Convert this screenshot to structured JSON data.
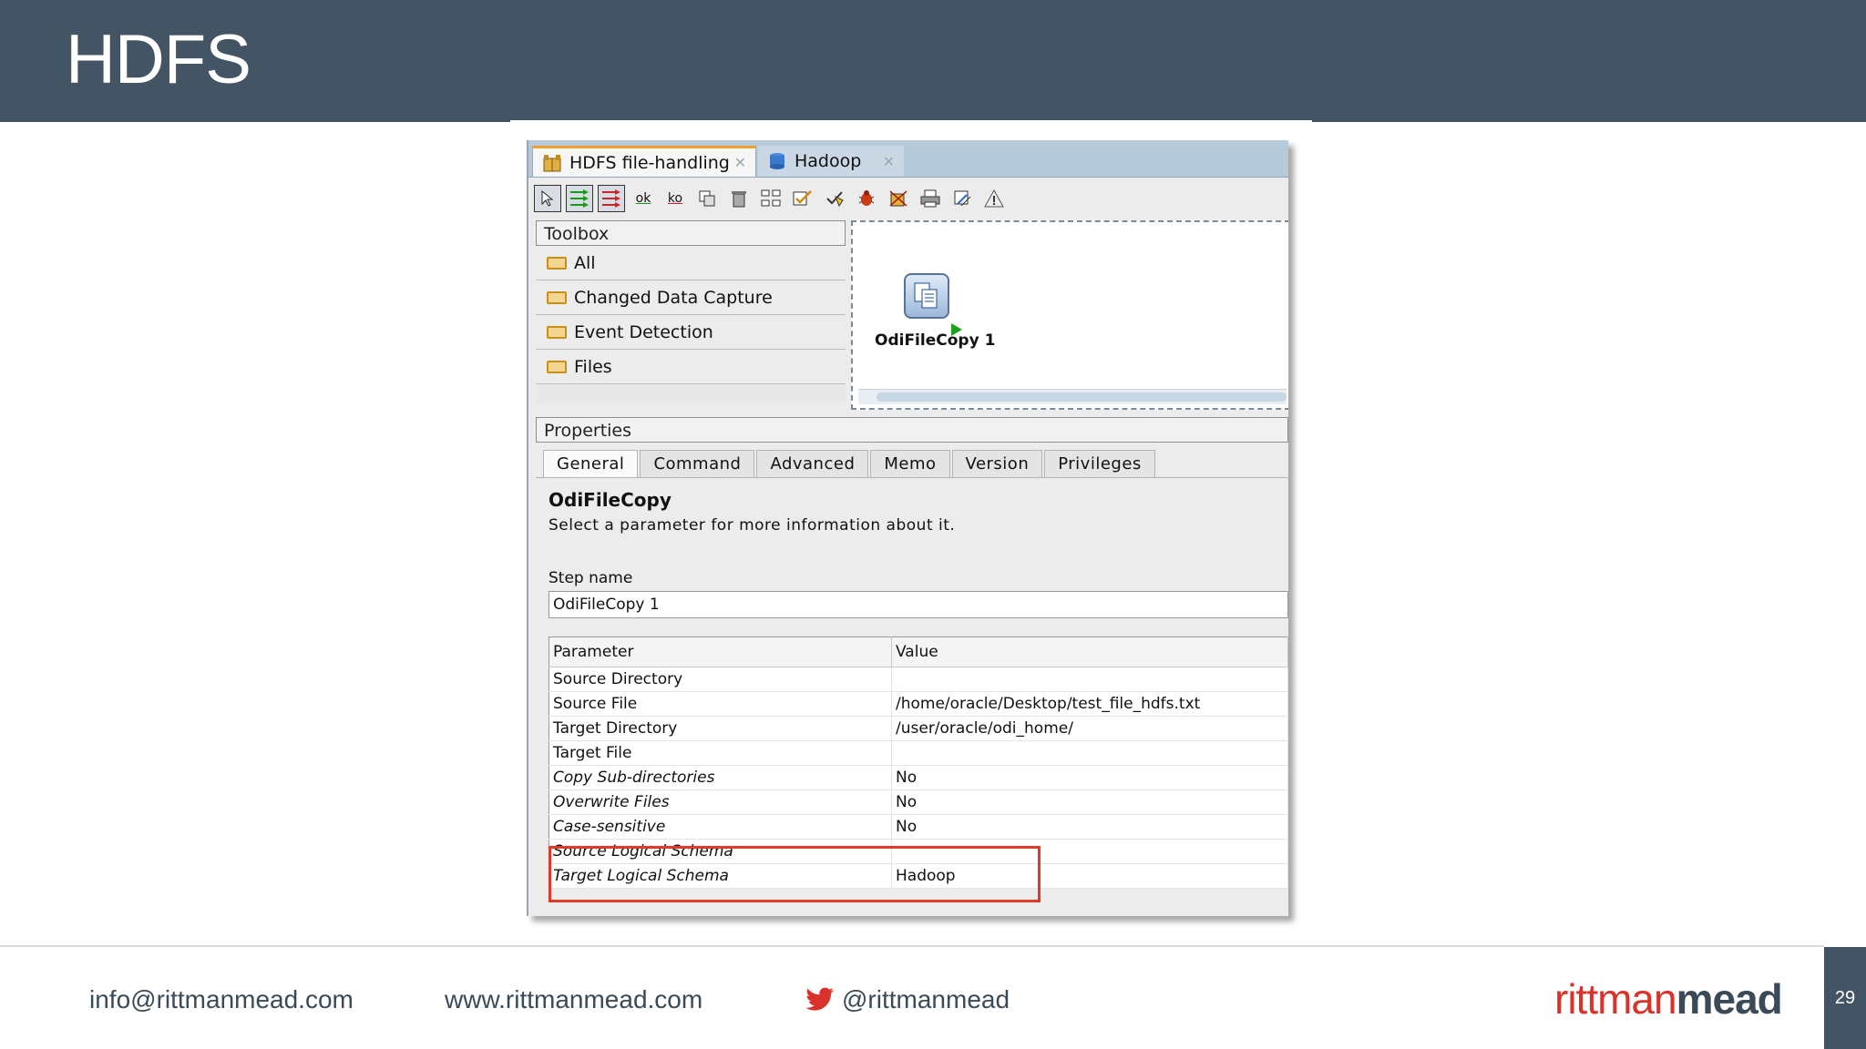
{
  "slide": {
    "title": "HDFS",
    "page_number": "29"
  },
  "editor_tabs": [
    {
      "label": "HDFS file-handling",
      "active": true
    },
    {
      "label": "Hadoop",
      "active": false
    }
  ],
  "toolbar": {
    "icons": [
      "select-arrow-icon",
      "next-step-ok-icon",
      "next-step-ko-icon",
      "ok-label-icon",
      "ko-label-icon",
      "duplicate-icon",
      "delete-icon",
      "layout-icon",
      "validate-icon",
      "execute-icon",
      "debug-icon",
      "stop-icon",
      "print-icon",
      "page-setup-icon",
      "warning-icon"
    ],
    "ok_label": "ok",
    "ko_label": "ko"
  },
  "toolbox": {
    "title": "Toolbox",
    "items": [
      "All",
      "Changed Data Capture",
      "Event Detection",
      "Files"
    ]
  },
  "diagram": {
    "node_label": "OdiFileCopy 1"
  },
  "properties": {
    "title": "Properties",
    "tabs": [
      "General",
      "Command",
      "Advanced",
      "Memo",
      "Version",
      "Privileges"
    ],
    "active_tab": "General",
    "heading": "OdiFileCopy",
    "description": "Select a parameter for more information about it.",
    "step_name_label": "Step name",
    "step_name_value": "OdiFileCopy 1",
    "table": {
      "headers": [
        "Parameter",
        "Value"
      ],
      "rows": [
        {
          "param": "Source Directory",
          "value": "",
          "italic": false
        },
        {
          "param": "Source File",
          "value": "/home/oracle/Desktop/test_file_hdfs.txt",
          "italic": false
        },
        {
          "param": "Target Directory",
          "value": "/user/oracle/odi_home/",
          "italic": false
        },
        {
          "param": "Target File",
          "value": "",
          "italic": false
        },
        {
          "param": "Copy Sub-directories",
          "value": "No",
          "italic": true
        },
        {
          "param": "Overwrite Files",
          "value": "No",
          "italic": true
        },
        {
          "param": "Case-sensitive",
          "value": "No",
          "italic": true
        },
        {
          "param": "Source Logical Schema",
          "value": "",
          "italic": true
        },
        {
          "param": "Target Logical Schema",
          "value": "Hadoop",
          "italic": true
        }
      ]
    }
  },
  "footer": {
    "email": "info@rittmanmead.com",
    "website": "www.rittmanmead.com",
    "twitter": "@rittmanmead",
    "brand_part1": "rittman",
    "brand_part2": "mead"
  },
  "colors": {
    "header_bg": "#435464",
    "highlight_border": "#e03a2a",
    "brand_red": "#d8322a",
    "brand_dark": "#3b4a58"
  }
}
